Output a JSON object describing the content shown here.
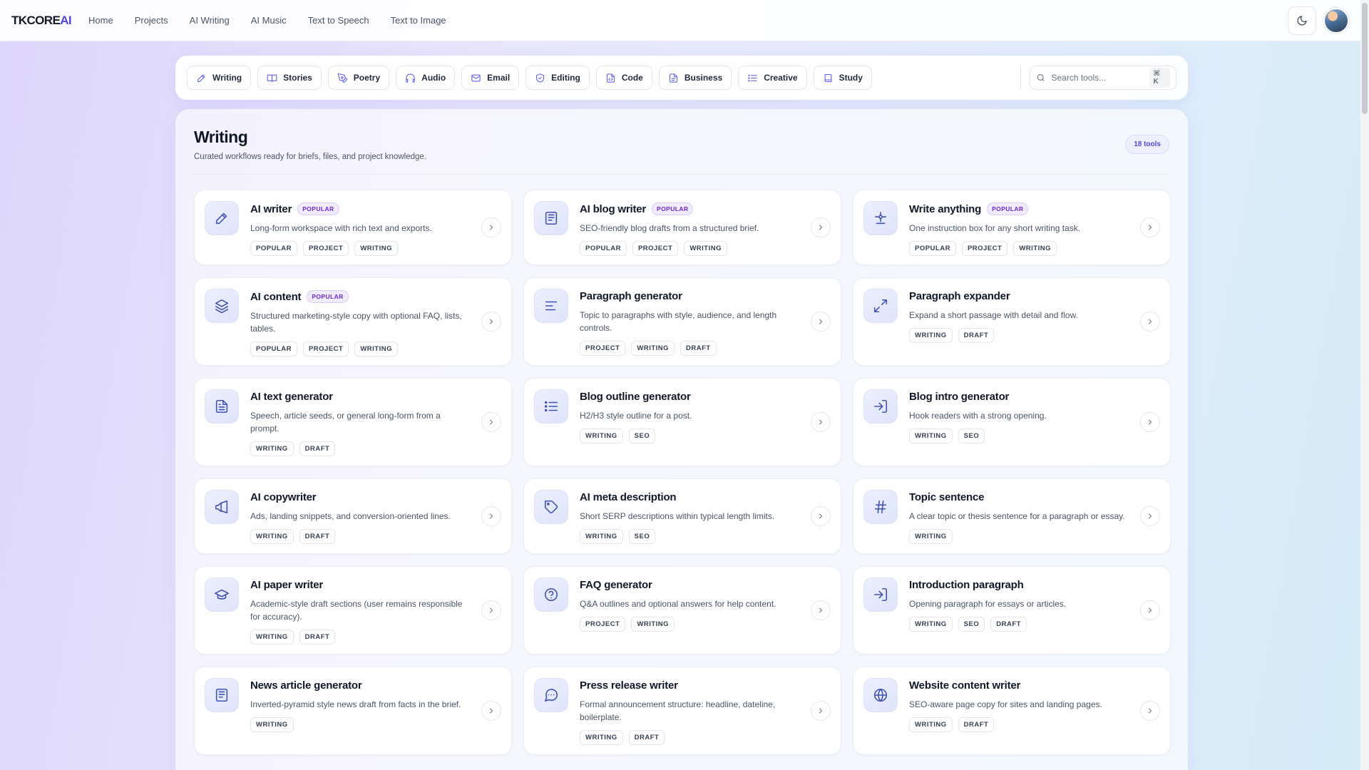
{
  "header": {
    "logo_main": "TKCORE",
    "logo_accent": "AI",
    "nav": [
      "Home",
      "Projects",
      "AI Writing",
      "AI Music",
      "Text to Speech",
      "Text to Image"
    ]
  },
  "categories": [
    {
      "label": "Writing",
      "icon": "pencil-icon"
    },
    {
      "label": "Stories",
      "icon": "book-open-icon"
    },
    {
      "label": "Poetry",
      "icon": "pen-nib-icon"
    },
    {
      "label": "Audio",
      "icon": "headphones-icon"
    },
    {
      "label": "Email",
      "icon": "mail-icon"
    },
    {
      "label": "Editing",
      "icon": "shield-check-icon"
    },
    {
      "label": "Code",
      "icon": "file-code-icon"
    },
    {
      "label": "Business",
      "icon": "document-icon"
    },
    {
      "label": "Creative",
      "icon": "list-icon"
    },
    {
      "label": "Study",
      "icon": "book-icon"
    }
  ],
  "search": {
    "placeholder": "Search tools...",
    "shortcut": "⌘ K"
  },
  "section": {
    "title": "Writing",
    "subtitle": "Curated workflows ready for briefs, files, and project knowledge.",
    "count": "18 tools"
  },
  "popular_label": "POPULAR",
  "tools": [
    {
      "title": "AI writer",
      "popular": true,
      "desc": "Long-form workspace with rich text and exports.",
      "tags": [
        "POPULAR",
        "PROJECT",
        "WRITING"
      ],
      "icon": "pencil-icon"
    },
    {
      "title": "AI blog writer",
      "popular": true,
      "desc": "SEO-friendly blog drafts from a structured brief.",
      "tags": [
        "POPULAR",
        "PROJECT",
        "WRITING"
      ],
      "icon": "newspaper-icon"
    },
    {
      "title": "Write anything",
      "popular": true,
      "desc": "One instruction box for any short writing task.",
      "tags": [
        "POPULAR",
        "PROJECT",
        "WRITING"
      ],
      "icon": "sparkle-icon"
    },
    {
      "title": "AI content",
      "popular": true,
      "desc": "Structured marketing-style copy with optional FAQ, lists, tables.",
      "tags": [
        "POPULAR",
        "PROJECT",
        "WRITING"
      ],
      "icon": "layers-icon"
    },
    {
      "title": "Paragraph generator",
      "popular": false,
      "desc": "Topic to paragraphs with style, audience, and length controls.",
      "tags": [
        "PROJECT",
        "WRITING",
        "DRAFT"
      ],
      "icon": "align-left-icon"
    },
    {
      "title": "Paragraph expander",
      "popular": false,
      "desc": "Expand a short passage with detail and flow.",
      "tags": [
        "WRITING",
        "DRAFT"
      ],
      "icon": "expand-icon"
    },
    {
      "title": "AI text generator",
      "popular": false,
      "desc": "Speech, article seeds, or general long-form from a prompt.",
      "tags": [
        "WRITING",
        "DRAFT"
      ],
      "icon": "file-text-icon"
    },
    {
      "title": "Blog outline generator",
      "popular": false,
      "desc": "H2/H3 style outline for a post.",
      "tags": [
        "WRITING",
        "SEO"
      ],
      "icon": "list-icon"
    },
    {
      "title": "Blog intro generator",
      "popular": false,
      "desc": "Hook readers with a strong opening.",
      "tags": [
        "WRITING",
        "SEO"
      ],
      "icon": "log-in-icon"
    },
    {
      "title": "AI copywriter",
      "popular": false,
      "desc": "Ads, landing snippets, and conversion-oriented lines.",
      "tags": [
        "WRITING",
        "DRAFT"
      ],
      "icon": "megaphone-icon"
    },
    {
      "title": "AI meta description",
      "popular": false,
      "desc": "Short SERP descriptions within typical length limits.",
      "tags": [
        "WRITING",
        "SEO"
      ],
      "icon": "tag-icon"
    },
    {
      "title": "Topic sentence",
      "popular": false,
      "desc": "A clear topic or thesis sentence for a paragraph or essay.",
      "tags": [
        "WRITING"
      ],
      "icon": "hash-icon"
    },
    {
      "title": "AI paper writer",
      "popular": false,
      "desc": "Academic-style draft sections (user remains responsible for accuracy).",
      "tags": [
        "WRITING",
        "DRAFT"
      ],
      "icon": "graduation-cap-icon"
    },
    {
      "title": "FAQ generator",
      "popular": false,
      "desc": "Q&A outlines and optional answers for help content.",
      "tags": [
        "PROJECT",
        "WRITING"
      ],
      "icon": "help-circle-icon"
    },
    {
      "title": "Introduction paragraph",
      "popular": false,
      "desc": "Opening paragraph for essays or articles.",
      "tags": [
        "WRITING",
        "SEO",
        "DRAFT"
      ],
      "icon": "log-in-icon"
    },
    {
      "title": "News article generator",
      "popular": false,
      "desc": "Inverted-pyramid style news draft from facts in the brief.",
      "tags": [
        "WRITING"
      ],
      "icon": "newspaper-icon"
    },
    {
      "title": "Press release writer",
      "popular": false,
      "desc": "Formal announcement structure: headline, dateline, boilerplate.",
      "tags": [
        "WRITING",
        "DRAFT"
      ],
      "icon": "message-circle-icon"
    },
    {
      "title": "Website content writer",
      "popular": false,
      "desc": "SEO-aware page copy for sites and landing pages.",
      "tags": [
        "WRITING",
        "DRAFT"
      ],
      "icon": "globe-icon"
    }
  ]
}
